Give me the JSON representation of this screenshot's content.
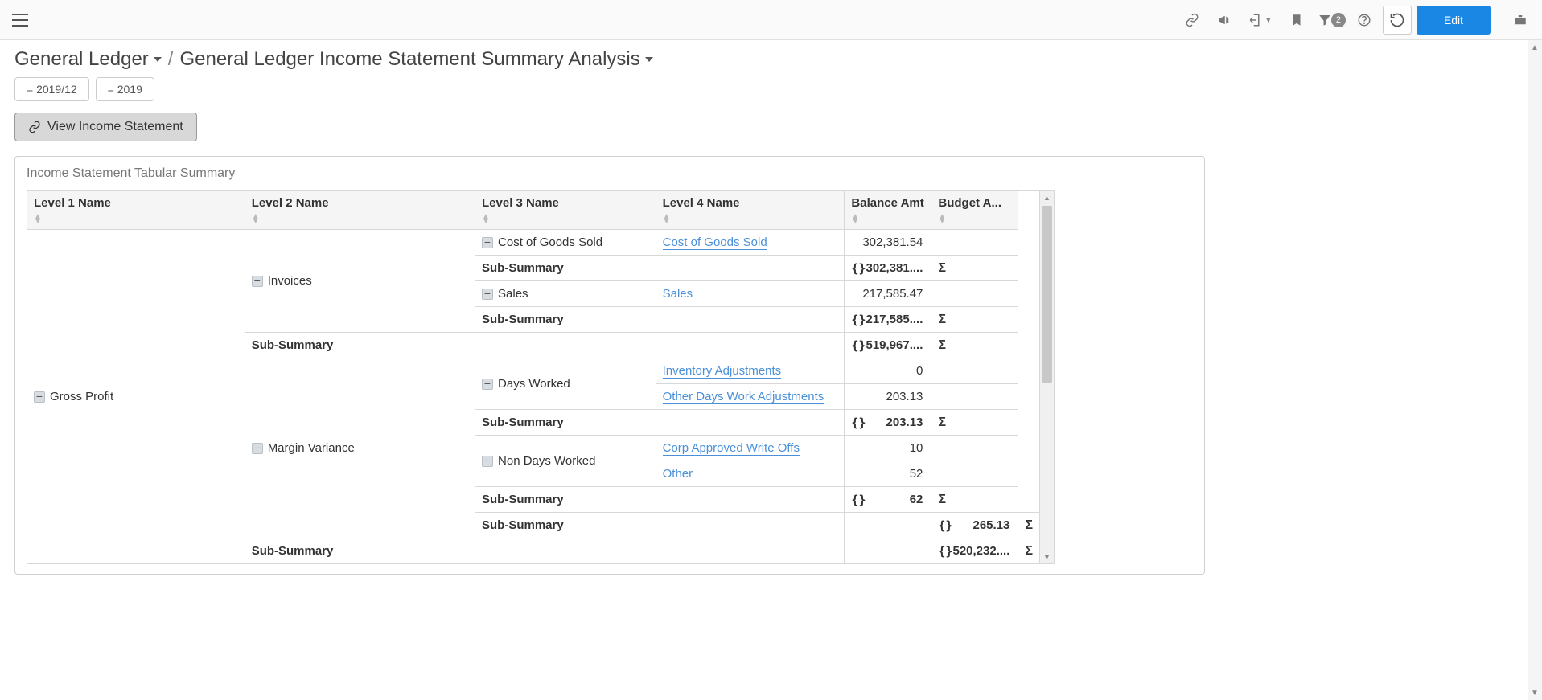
{
  "toolbar": {
    "filter_count": "2",
    "edit_label": "Edit"
  },
  "breadcrumb": {
    "root": "General Ledger",
    "sep": "/",
    "current": "General Ledger Income Statement Summary Analysis"
  },
  "filters": {
    "period": "= 2019/12",
    "year": "= 2019"
  },
  "view_button": "View Income Statement",
  "panel": {
    "title": "Income Statement Tabular Summary"
  },
  "columns": {
    "l1": "Level 1 Name",
    "l2": "Level 2 Name",
    "l3": "Level 3 Name",
    "l4": "Level 4 Name",
    "bal": "Balance Amt",
    "bud": "Budget A..."
  },
  "labels": {
    "sub_summary": "Sub-Summary",
    "curly": "{}",
    "sigma": "Σ"
  },
  "rows": {
    "gross_profit": "Gross Profit",
    "invoices": "Invoices",
    "margin_variance": "Margin Variance",
    "cogs_l3": "Cost of Goods Sold",
    "cogs_l4": "Cost of Goods Sold",
    "cogs_amt": "302,381.54",
    "cogs_sub_amt": "302,381....",
    "sales_l3": "Sales",
    "sales_l4": "Sales",
    "sales_amt": "217,585.47",
    "sales_sub_amt": "217,585....",
    "invoices_sub_amt": "519,967....",
    "days_worked": "Days Worked",
    "inv_adj": "Inventory Adjustments",
    "inv_adj_amt": "0",
    "other_days": "Other Days Work Adjustments",
    "other_days_amt": "203.13",
    "days_sub_amt": "203.13",
    "non_days": "Non Days Worked",
    "corp_writeoff": "Corp Approved Write Offs",
    "corp_writeoff_amt": "10",
    "other": "Other",
    "other_amt": "52",
    "non_days_sub_amt": "62",
    "margin_sub_amt": "265.13",
    "gp_sub_amt": "520,232...."
  }
}
